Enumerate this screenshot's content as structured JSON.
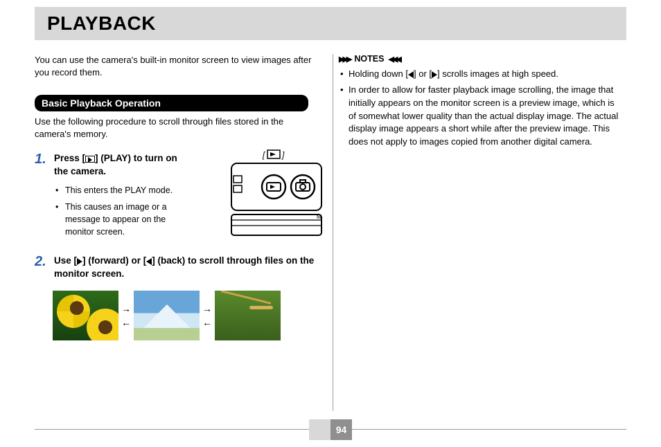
{
  "title": "PLAYBACK",
  "page_number": "94",
  "left": {
    "intro": "You can use the camera's built-in monitor screen to view images after you record them.",
    "section_title": "Basic Playback Operation",
    "section_desc": "Use the following procedure to scroll through files stored in the camera's memory.",
    "steps": [
      {
        "num": "1.",
        "head_before": "Press [",
        "head_after": "] (PLAY) to turn on the camera.",
        "bullets": [
          "This enters the PLAY mode.",
          "This causes an image or a message to appear on the monitor screen."
        ]
      },
      {
        "num": "2.",
        "head_before": "Use [",
        "head_mid": "] (forward) or [",
        "head_after": "] (back) to scroll through files on the monitor screen."
      }
    ]
  },
  "right": {
    "notes_label": "NOTES",
    "notes": [
      {
        "pre": "Holding down [",
        "mid": "] or [",
        "post": "] scrolls images at high speed."
      },
      {
        "text": "In order to allow for faster playback image scrolling, the image that initially appears on the monitor screen is a preview image, which is of somewhat lower quality than the actual display image. The actual display image appears a short while after the preview image. This does not apply to images copied from another digital camera."
      }
    ]
  },
  "arrows": {
    "right": "→",
    "left": "←"
  }
}
